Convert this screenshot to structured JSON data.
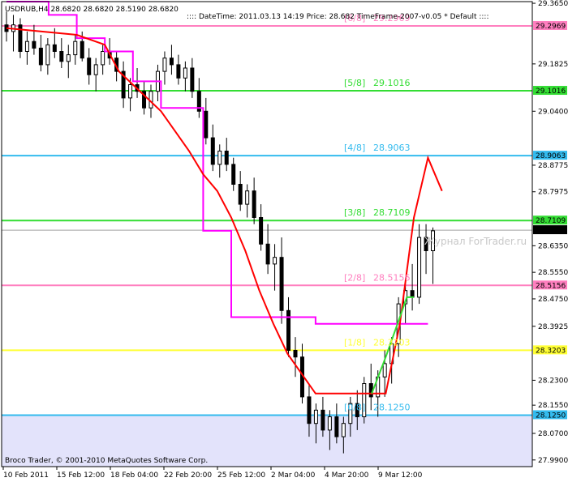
{
  "header": {
    "symbol_info": "USDRUB,H4  28.6820 28.6820 28.5190 28.6820",
    "info": ":::: DateTime: 2011.03.13 14:19   Price: 28.682   TimeFrame-2007-v0.05    *  Default  ::::"
  },
  "watermark": "Журнал ForTrader.ru",
  "copyright": "Broco Trader, © 2001-2010 MetaQuotes Software Corp.",
  "colors": {
    "pink": "#ff7fbf",
    "green": "#33dd33",
    "cyan": "#33bbee",
    "yellow": "#ffff33",
    "magenta": "#ff00ff",
    "red": "#ff0000",
    "band": "#e3e3fb"
  },
  "chart_data": {
    "type": "candlestick",
    "y_range": [
      27.97,
      29.37
    ],
    "y_ticks": [
      "29.3650",
      "29.1825",
      "29.0400",
      "28.8775",
      "28.7975",
      "28.6350",
      "28.5550",
      "28.4750",
      "28.3925",
      "28.2300",
      "28.1550",
      "28.0700",
      "27.9900"
    ],
    "x_ticks": [
      "10 Feb 2011",
      "15 Feb 12:00",
      "18 Feb 04:00",
      "22 Feb 20:00",
      "25 Feb 12:00",
      "2 Mar 04:00",
      "4 Mar 20:00",
      "9 Mar 12:00"
    ],
    "current_price": "28.6820",
    "murrey_levels": [
      {
        "label": "[6/8]",
        "value": "29.2969",
        "tag": "29.2969",
        "color": "pink"
      },
      {
        "label": "[5/8]",
        "value": "29.1016",
        "tag": "29.1016",
        "color": "green"
      },
      {
        "label": "[4/8]",
        "value": "28.9063",
        "tag": "28.9063",
        "color": "cyan"
      },
      {
        "label": "[3/8]",
        "value": "28.7109",
        "tag": "28.7109",
        "color": "green"
      },
      {
        "label": "[2/8]",
        "value": "28.5156",
        "tag": "28.5156",
        "color": "pink"
      },
      {
        "label": "[1/8]",
        "value": "28.3203",
        "tag": "28.3203",
        "color": "yellow"
      },
      {
        "label": "[0/8]",
        "value": "28.1250",
        "tag": "28.1250",
        "color": "cyan"
      }
    ],
    "magenta_line": [
      [
        0,
        29.37
      ],
      [
        3,
        29.37
      ],
      [
        3,
        29.33
      ],
      [
        5,
        29.33
      ],
      [
        5,
        29.26
      ],
      [
        7,
        29.26
      ],
      [
        7,
        29.22
      ],
      [
        9,
        29.22
      ],
      [
        9,
        29.13
      ],
      [
        11,
        29.13
      ],
      [
        11,
        29.05
      ],
      [
        14,
        29.05
      ],
      [
        14,
        28.68
      ],
      [
        16,
        28.68
      ],
      [
        16,
        28.42
      ],
      [
        22,
        28.42
      ],
      [
        22,
        28.4
      ],
      [
        30,
        28.4
      ]
    ],
    "magenta_top": [
      [
        3,
        29.37
      ],
      [
        3,
        29.37
      ]
    ],
    "red_line": [
      [
        0,
        29.29
      ],
      [
        5,
        29.27
      ],
      [
        7,
        29.24
      ],
      [
        8,
        29.16
      ],
      [
        9,
        29.12
      ],
      [
        10,
        29.08
      ],
      [
        11,
        29.04
      ],
      [
        12,
        28.98
      ],
      [
        13,
        28.92
      ],
      [
        14,
        28.85
      ],
      [
        15,
        28.8
      ],
      [
        16,
        28.72
      ],
      [
        17,
        28.62
      ],
      [
        18,
        28.5
      ],
      [
        19,
        28.4
      ],
      [
        20,
        28.31
      ],
      [
        21,
        28.25
      ],
      [
        22,
        28.19
      ],
      [
        26,
        28.19
      ],
      [
        27,
        28.19
      ],
      [
        28,
        28.4
      ],
      [
        29,
        28.72
      ],
      [
        30,
        28.9
      ],
      [
        31,
        28.8
      ]
    ],
    "green_line": [
      [
        26,
        28.19
      ],
      [
        27,
        28.3
      ],
      [
        28,
        28.42
      ],
      [
        28.5,
        28.48
      ],
      [
        29,
        28.48
      ]
    ],
    "candles_note": "approximate OHLC bars",
    "candles": [
      [
        29.3,
        29.34,
        29.25,
        29.28
      ],
      [
        29.28,
        29.33,
        29.22,
        29.3
      ],
      [
        29.3,
        29.32,
        29.2,
        29.22
      ],
      [
        29.22,
        29.28,
        29.18,
        29.25
      ],
      [
        29.25,
        29.3,
        29.21,
        29.23
      ],
      [
        29.23,
        29.27,
        29.16,
        29.18
      ],
      [
        29.18,
        29.26,
        29.15,
        29.24
      ],
      [
        29.24,
        29.29,
        29.2,
        29.22
      ],
      [
        29.22,
        29.26,
        29.17,
        29.19
      ],
      [
        29.19,
        29.24,
        29.14,
        29.21
      ],
      [
        29.21,
        29.27,
        29.18,
        29.25
      ],
      [
        29.25,
        29.28,
        29.19,
        29.2
      ],
      [
        29.2,
        29.23,
        29.12,
        29.15
      ],
      [
        29.15,
        29.2,
        29.1,
        29.18
      ],
      [
        29.18,
        29.24,
        29.15,
        29.22
      ],
      [
        29.22,
        29.26,
        29.18,
        29.2
      ],
      [
        29.2,
        29.22,
        29.13,
        29.16
      ],
      [
        29.16,
        29.19,
        29.05,
        29.08
      ],
      [
        29.08,
        29.14,
        29.04,
        29.12
      ],
      [
        29.12,
        29.17,
        29.08,
        29.1
      ],
      [
        29.1,
        29.13,
        29.03,
        29.05
      ],
      [
        29.05,
        29.12,
        29.02,
        29.1
      ],
      [
        29.1,
        29.18,
        29.07,
        29.16
      ],
      [
        29.16,
        29.22,
        29.12,
        29.2
      ],
      [
        29.2,
        29.24,
        29.15,
        29.18
      ],
      [
        29.18,
        29.21,
        29.12,
        29.14
      ],
      [
        29.14,
        29.19,
        29.1,
        29.17
      ],
      [
        29.17,
        29.2,
        29.08,
        29.1
      ],
      [
        29.1,
        29.14,
        29.02,
        29.04
      ],
      [
        29.04,
        29.08,
        28.94,
        28.96
      ],
      [
        28.96,
        29.0,
        28.86,
        28.88
      ],
      [
        28.88,
        28.94,
        28.84,
        28.92
      ],
      [
        28.92,
        28.96,
        28.86,
        28.88
      ],
      [
        28.88,
        28.9,
        28.8,
        28.82
      ],
      [
        28.82,
        28.86,
        28.74,
        28.76
      ],
      [
        28.76,
        28.82,
        28.72,
        28.8
      ],
      [
        28.8,
        28.84,
        28.7,
        28.72
      ],
      [
        28.72,
        28.76,
        28.62,
        28.64
      ],
      [
        28.64,
        28.7,
        28.55,
        28.58
      ],
      [
        28.58,
        28.64,
        28.5,
        28.6
      ],
      [
        28.6,
        28.66,
        28.4,
        28.44
      ],
      [
        28.44,
        28.48,
        28.3,
        28.32
      ],
      [
        28.32,
        28.36,
        28.24,
        28.3
      ],
      [
        28.3,
        28.34,
        28.16,
        28.18
      ],
      [
        28.18,
        28.22,
        28.06,
        28.1
      ],
      [
        28.1,
        28.16,
        28.04,
        28.14
      ],
      [
        28.14,
        28.18,
        28.06,
        28.08
      ],
      [
        28.08,
        28.14,
        28.02,
        28.12
      ],
      [
        28.12,
        28.16,
        28.04,
        28.06
      ],
      [
        28.06,
        28.12,
        28.01,
        28.1
      ],
      [
        28.1,
        28.18,
        28.06,
        28.16
      ],
      [
        28.16,
        28.2,
        28.08,
        28.12
      ],
      [
        28.12,
        28.24,
        28.1,
        28.22
      ],
      [
        28.22,
        28.28,
        28.14,
        28.18
      ],
      [
        28.18,
        28.26,
        28.12,
        28.24
      ],
      [
        28.24,
        28.32,
        28.18,
        28.28
      ],
      [
        28.28,
        28.36,
        28.22,
        28.34
      ],
      [
        28.34,
        28.48,
        28.3,
        28.46
      ],
      [
        28.46,
        28.54,
        28.4,
        28.5
      ],
      [
        28.5,
        28.58,
        28.44,
        28.48
      ],
      [
        28.48,
        28.7,
        28.46,
        28.66
      ],
      [
        28.66,
        28.7,
        28.55,
        28.62
      ],
      [
        28.62,
        28.69,
        28.52,
        28.68
      ]
    ]
  }
}
